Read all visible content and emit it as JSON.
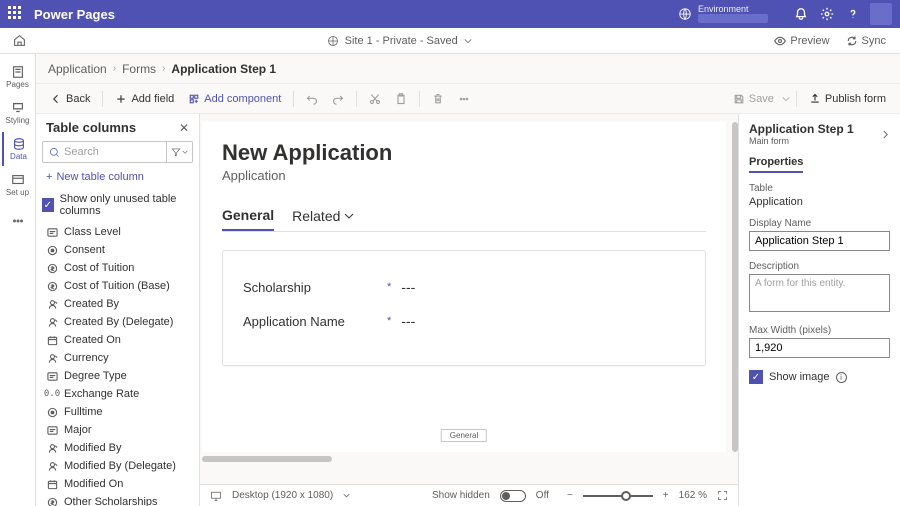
{
  "brand": {
    "title": "Power Pages",
    "env_label": "Environment"
  },
  "context": {
    "site": "Site 1 - Private - Saved",
    "preview": "Preview",
    "sync": "Sync"
  },
  "rail": {
    "pages": "Pages",
    "styling": "Styling",
    "data": "Data",
    "setup": "Set up"
  },
  "breadcrumb": {
    "a": "Application",
    "b": "Forms",
    "c": "Application Step 1"
  },
  "toolbar": {
    "back": "Back",
    "addfield": "Add field",
    "addcomp": "Add component",
    "save": "Save",
    "publish": "Publish form"
  },
  "tcol": {
    "title": "Table columns",
    "search": "Search",
    "new": "New table column",
    "showunused": "Show only unused table columns",
    "items": [
      "Class Level",
      "Consent",
      "Cost of Tuition",
      "Cost of Tuition (Base)",
      "Created By",
      "Created By (Delegate)",
      "Created On",
      "Currency",
      "Degree Type",
      "Exchange Rate",
      "Fulltime",
      "Major",
      "Modified By",
      "Modified By (Delegate)",
      "Modified On",
      "Other Scholarships"
    ]
  },
  "tcol_icons": [
    "opt",
    "rad",
    "cur",
    "cur",
    "usr",
    "usr",
    "cal",
    "usr",
    "opt",
    "num",
    "rad",
    "opt",
    "usr",
    "usr",
    "cal",
    "cur"
  ],
  "form": {
    "title": "New Application",
    "subtitle": "Application",
    "tab_general": "General",
    "tab_related": "Related",
    "f1_label": "Scholarship",
    "f1_val": "---",
    "f2_label": "Application Name",
    "f2_val": "---",
    "general_box": "General"
  },
  "status": {
    "desktop": "Desktop (1920 x 1080)",
    "showhidden": "Show hidden",
    "off": "Off",
    "zoom": "162 %"
  },
  "props": {
    "title": "Application Step 1",
    "sub": "Main form",
    "tab": "Properties",
    "table_lbl": "Table",
    "table_val": "Application",
    "name_lbl": "Display Name",
    "name_val": "Application Step 1",
    "desc_lbl": "Description",
    "desc_val": "A form for this entity.",
    "maxw_lbl": "Max Width (pixels)",
    "maxw_val": "1,920",
    "showimg": "Show image"
  }
}
